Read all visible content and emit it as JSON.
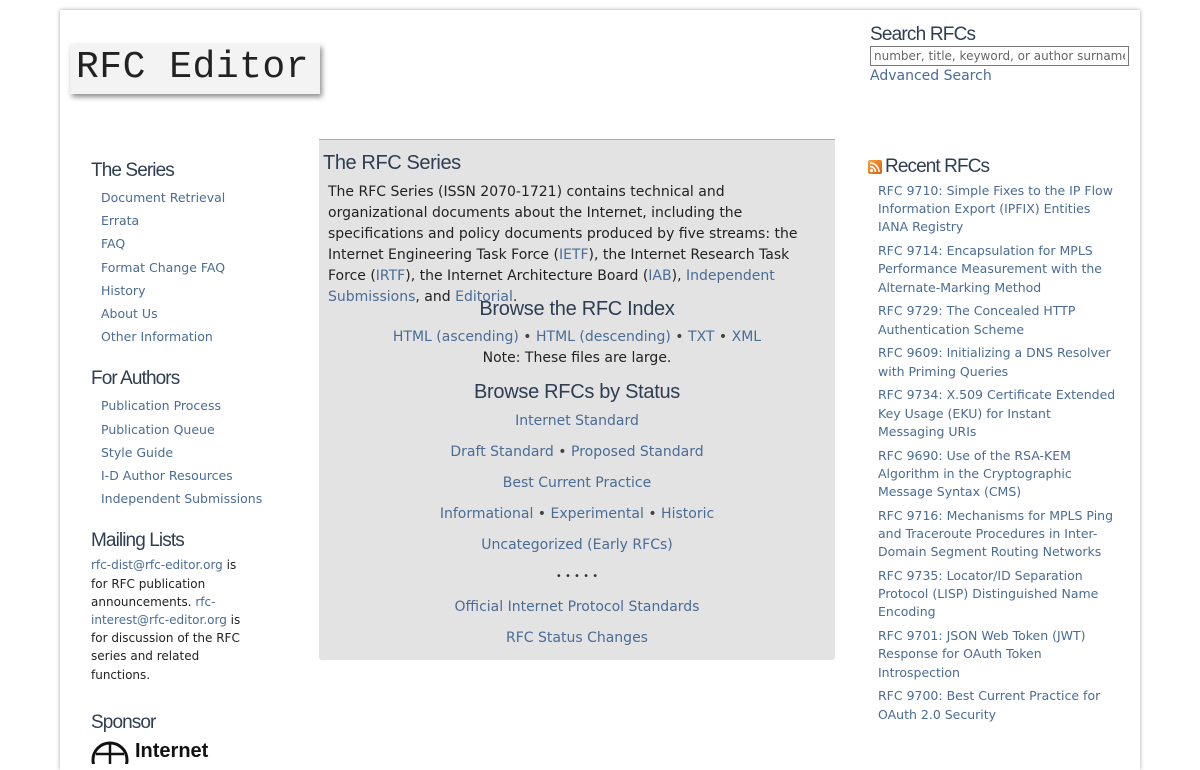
{
  "header": {
    "logo_text": "RFC Editor",
    "search_title": "Search RFCs",
    "search_placeholder": "number, title, keyword, or author surname",
    "advanced_search": "Advanced Search"
  },
  "sidebar": {
    "series_title": "The Series",
    "series_items": [
      "Document Retrieval",
      "Errata",
      "FAQ",
      "Format Change FAQ",
      "History",
      "About Us",
      "Other Information"
    ],
    "authors_title": "For Authors",
    "authors_items": [
      "Publication Process",
      "Publication Queue",
      "Style Guide",
      "I-D Author Resources",
      "Independent Submissions"
    ],
    "mailing_title": "Mailing Lists",
    "mailing": {
      "link1": "rfc-dist@rfc-editor.org",
      "text1": " is for RFC publication announcements. ",
      "link2": "rfc-interest@rfc-editor.org",
      "text2": " is for discussion of the RFC series and related functions."
    },
    "sponsor_title": "Sponsor",
    "sponsor_name": "Internet"
  },
  "main": {
    "title": "The RFC Series",
    "intro": {
      "t1": "The RFC Series (ISSN 2070-1721) contains technical and organizational documents about the Internet, including the specifications and policy documents produced by five streams: the Internet Engineering Task Force (",
      "ietf": "IETF",
      "t2": "), the Internet Research Task Force (",
      "irtf": "IRTF",
      "t3": "), the Internet Architecture Board (",
      "iab": "IAB",
      "t4": "), ",
      "independent": "Independent Submissions",
      "t5": ", and ",
      "editorial": "Editorial",
      "t6": "."
    },
    "index_title": "Browse the RFC Index",
    "index_links": {
      "html_asc": "HTML (ascending)",
      "html_desc": "HTML (descending)",
      "txt": "TXT",
      "xml": "XML"
    },
    "index_note": "Note: These files are large.",
    "status_title": "Browse RFCs by Status",
    "status": {
      "internet_standard": "Internet Standard",
      "draft_standard": "Draft Standard",
      "proposed_standard": "Proposed Standard",
      "bcp": "Best Current Practice",
      "informational": "Informational",
      "experimental": "Experimental",
      "historic": "Historic",
      "uncategorized": "Uncategorized (Early RFCs)",
      "dots": "• • • • •",
      "official_standards": "Official Internet Protocol Standards",
      "status_changes": "RFC Status Changes"
    },
    "bullet": " • "
  },
  "recent": {
    "title": "Recent RFCs",
    "items": [
      "RFC 9710: Simple Fixes to the IP Flow Information Export (IPFIX) Entities IANA Registry",
      "RFC 9714: Encapsulation for MPLS Performance Measurement with the Alternate-Marking Method",
      "RFC 9729: The Concealed HTTP Authentication Scheme",
      "RFC 9609: Initializing a DNS Resolver with Priming Queries",
      "RFC 9734: X.509 Certificate Extended Key Usage (EKU) for Instant Messaging URIs",
      "RFC 9690: Use of the RSA-KEM Algorithm in the Cryptographic Message Syntax (CMS)",
      "RFC 9716: Mechanisms for MPLS Ping and Traceroute Procedures in Inter-Domain Segment Routing Networks",
      "RFC 9735: Locator/ID Separation Protocol (LISP) Distinguished Name Encoding",
      "RFC 9701: JSON Web Token (JWT) Response for OAuth Token Introspection",
      "RFC 9700: Best Current Practice for OAuth 2.0 Security"
    ]
  }
}
